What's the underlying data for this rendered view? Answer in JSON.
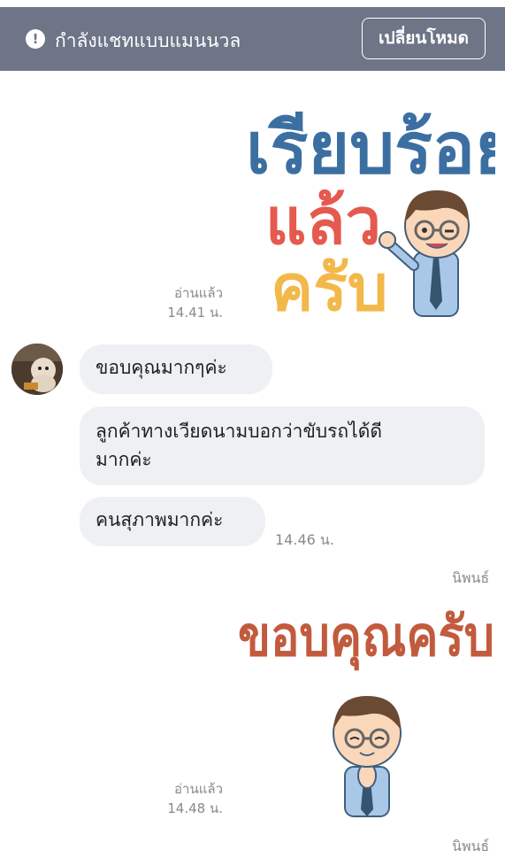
{
  "header": {
    "alert_icon": "exclamation-circle-icon",
    "title": "กำลังแชทแบบแมนนวล",
    "switch_mode_label": "เปลี่ยนโหมด"
  },
  "messages": {
    "sticker1": {
      "line1": "เรียบร้อย",
      "line2": "แล้ว",
      "line3": "ครับ",
      "read_label": "อ่านแล้ว",
      "time": "14.41 น."
    },
    "incoming": {
      "avatar": "user-avatar-dog",
      "bubble1": "ขอบคุณมากๆค่ะ",
      "bubble2_line1": "ลูกค้าทางเวียดนามบอกว่าขับรถได้ดี",
      "bubble2_line2": "มากค่ะ",
      "bubble3": "คนสุภาพมากค่ะ",
      "time": "14.46 น."
    },
    "sticker2": {
      "typed_label": "นิพนธ์",
      "text": "ขอบคุณครับ",
      "read_label": "อ่านแล้ว",
      "time": "14.48 น."
    },
    "footer_typed_label": "นิพนธ์"
  },
  "colors": {
    "header_bg": "#6d7587",
    "bubble_bg": "#eef0f3"
  }
}
